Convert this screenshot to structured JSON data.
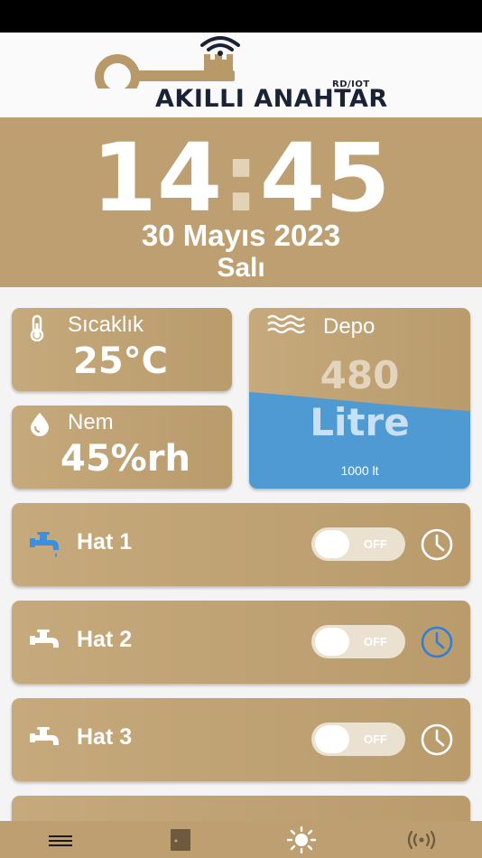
{
  "logo": {
    "text": "AKILLI ANAHTAR",
    "tag": "RD/IOT",
    "icon": "key-wifi-logo"
  },
  "clock": {
    "hours": "14",
    "separator": ":",
    "minutes": "45",
    "date": "30 Mayıs 2023",
    "day": "Salı"
  },
  "temperature": {
    "title": "Sıcaklık",
    "value": "25°C",
    "icon": "thermometer-icon"
  },
  "humidity": {
    "title": "Nem",
    "value": "45%rh",
    "icon": "droplet-icon"
  },
  "tank": {
    "title": "Depo",
    "value": "480",
    "unit": "Litre",
    "capacity": "1000 lt",
    "icon": "water-waves-icon",
    "fill_level": 0.48
  },
  "lines": [
    {
      "label": "Hat 1",
      "state": "OFF",
      "icon": "faucet-icon",
      "icon_color": "#3b8fe0",
      "clock_color": "#ffffff"
    },
    {
      "label": "Hat 2",
      "state": "OFF",
      "icon": "faucet-icon",
      "icon_color": "#ffffff",
      "clock_color": "#2f7fd9"
    },
    {
      "label": "Hat 3",
      "state": "OFF",
      "icon": "faucet-icon",
      "icon_color": "#ffffff",
      "clock_color": "#ffffff"
    }
  ],
  "nav": {
    "items": [
      {
        "name": "menu",
        "icon": "hamburger-icon"
      },
      {
        "name": "door",
        "icon": "door-icon"
      },
      {
        "name": "light",
        "icon": "sun-icon"
      },
      {
        "name": "signal",
        "icon": "signal-icon"
      }
    ]
  },
  "colors": {
    "accent": "#bd9f71",
    "water": "#4f9ad3",
    "logo_dark": "#1a2236"
  }
}
